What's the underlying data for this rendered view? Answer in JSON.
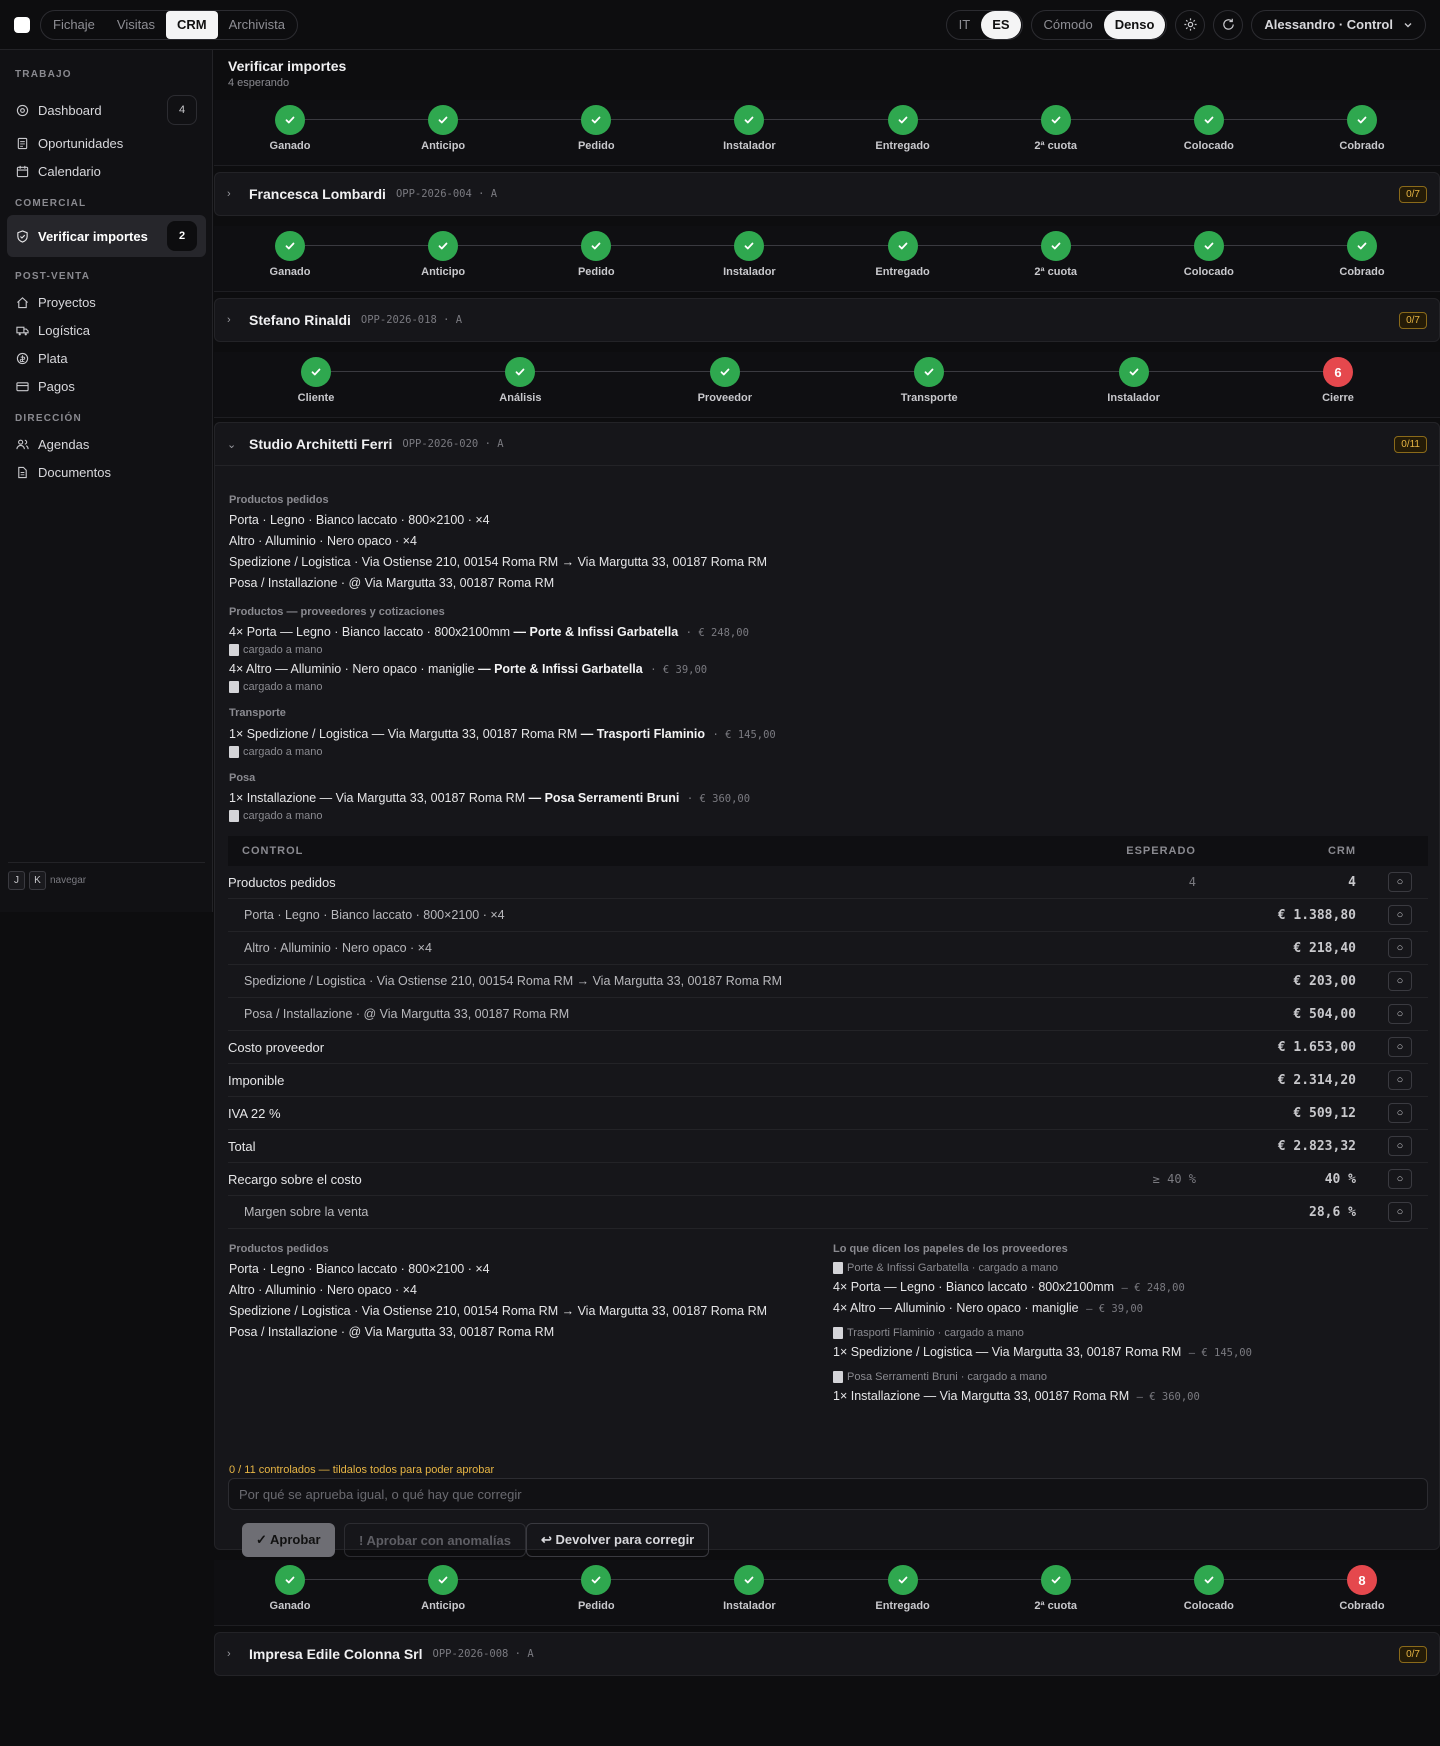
{
  "topbar": {
    "tabs": [
      "Fichaje",
      "Visitas",
      "CRM",
      "Archivista"
    ],
    "langs": [
      "IT",
      "ES"
    ],
    "density": [
      "Cómodo",
      "Denso"
    ],
    "user": "Alessandro · Control"
  },
  "sidebar": {
    "sections": {
      "trabajo": "TRABAJO",
      "comercial": "COMERCIAL",
      "postventa": "POST-VENTA",
      "direccion": "DIRECCIÓN"
    },
    "items": [
      {
        "label": "Dashboard",
        "badge": "4",
        "icon": "target-icon"
      },
      {
        "label": "Oportunidades",
        "icon": "document-icon"
      },
      {
        "label": "Calendario",
        "icon": "calendar-icon"
      },
      {
        "label": "Verificar importes",
        "badge": "2",
        "icon": "shield-icon"
      },
      {
        "label": "Proyectos",
        "icon": "home-icon"
      },
      {
        "label": "Logística",
        "icon": "truck-icon"
      },
      {
        "label": "Plata",
        "icon": "coin-icon"
      },
      {
        "label": "Pagos",
        "icon": "card-icon"
      },
      {
        "label": "Agendas",
        "icon": "users-icon"
      },
      {
        "label": "Documentos",
        "icon": "file-icon"
      }
    ],
    "footer": {
      "k1": "J",
      "k2": "K",
      "label": "navegar"
    }
  },
  "page": {
    "title": "Verificar importes",
    "subtitle": "4 esperando"
  },
  "steppers": {
    "standard": [
      "Ganado",
      "Anticipo",
      "Pedido",
      "Instalador",
      "Entregado",
      "2ª cuota",
      "Colocado",
      "Cobrado"
    ],
    "alt": [
      "Cliente",
      "Análisis",
      "Proveedor",
      "Transporte",
      "Instalador",
      "Cierre"
    ],
    "alt_failed_count": "6",
    "last_failed_count": "8"
  },
  "opps": [
    {
      "name": "Francesca Lombardi",
      "code": "OPP-2026-004 · A",
      "count": "0/7"
    },
    {
      "name": "Stefano Rinaldi",
      "code": "OPP-2026-018 · A",
      "count": "0/7"
    },
    {
      "name": "Studio Architetti Ferri",
      "code": "OPP-2026-020 · A",
      "count": "0/11"
    },
    {
      "name": "Impresa Edile Colonna Srl",
      "code": "OPP-2026-008 · A",
      "count": "0/7"
    }
  ],
  "detail": {
    "ordered_title": "Productos pedidos",
    "ordered": [
      "Porta · Legno · Bianco laccato · 800×2100 · ×4",
      "Altro · Alluminio · Nero opaco · ×4",
      "Spedizione / Logistica · Via Ostiense 210, 00154 Roma RM → Via Margutta 33, 00187 Roma RM",
      "Posa / Installazione · @ Via Margutta 33, 00187 Roma RM"
    ],
    "suppliers_title": "Productos — proveedores y cotizaciones",
    "transport_title": "Transporte",
    "posa_title": "Posa",
    "manual_note": "cargado a mano",
    "quotes": [
      {
        "text": "4× Porta — Legno · Bianco laccato · 800x2100mm",
        "supplier": "— Porte & Infissi Garbatella",
        "price": "· € 248,00"
      },
      {
        "text": "4× Altro — Alluminio · Nero opaco · maniglie",
        "supplier": "— Porte & Infissi Garbatella",
        "price": "· € 39,00"
      },
      {
        "text": "1× Spedizione / Logistica — Via Margutta 33, 00187 Roma RM",
        "supplier": "— Trasporti Flaminio",
        "price": "· € 145,00"
      },
      {
        "text": "1× Installazione — Via Margutta 33, 00187 Roma RM",
        "supplier": "— Posa Serramenti Bruni",
        "price": "· € 360,00"
      }
    ]
  },
  "control": {
    "headers": {
      "control": "CONTROL",
      "expected": "ESPERADO",
      "crm": "CRM"
    },
    "check_symbol": "○",
    "rows": [
      {
        "label": "Productos pedidos",
        "expected": "4",
        "crm": "4",
        "sub": false
      },
      {
        "label": "Porta · Legno · Bianco laccato · 800×2100 · ×4",
        "expected": "",
        "crm": "€ 1.388,80",
        "sub": true
      },
      {
        "label": "Altro · Alluminio · Nero opaco · ×4",
        "expected": "",
        "crm": "€ 218,40",
        "sub": true
      },
      {
        "label": "Spedizione / Logistica · Via Ostiense 210, 00154 Roma RM → Via Margutta 33, 00187 Roma RM",
        "expected": "",
        "crm": "€ 203,00",
        "sub": true
      },
      {
        "label": "Posa / Installazione · @ Via Margutta 33, 00187 Roma RM",
        "expected": "",
        "crm": "€ 504,00",
        "sub": true
      },
      {
        "label": "Costo proveedor",
        "expected": "",
        "crm": "€ 1.653,00",
        "sub": false
      },
      {
        "label": "Imponible",
        "expected": "",
        "crm": "€ 2.314,20",
        "sub": false
      },
      {
        "label": "IVA 22 %",
        "expected": "",
        "crm": "€ 509,12",
        "sub": false
      },
      {
        "label": "Total",
        "expected": "",
        "crm": "€ 2.823,32",
        "sub": false
      },
      {
        "label": "Recargo sobre el costo",
        "expected": "≥ 40 %",
        "crm": "40 %",
        "sub": false
      },
      {
        "label": "Margen sobre la venta",
        "expected": "",
        "crm": "28,6 %",
        "sub": true
      }
    ]
  },
  "papers": {
    "title": "Lo que dicen los papeles de los proveedores",
    "groups": [
      {
        "source": "Porte & Infissi Garbatella · cargado a mano",
        "lines": [
          {
            "text": "4× Porta — Legno · Bianco laccato · 800x2100mm",
            "price": "— € 248,00"
          },
          {
            "text": "4× Altro — Alluminio · Nero opaco · maniglie",
            "price": "— € 39,00"
          }
        ]
      },
      {
        "source": "Trasporti Flaminio · cargado a mano",
        "lines": [
          {
            "text": "1× Spedizione / Logistica — Via Margutta 33, 00187 Roma RM",
            "price": "— € 145,00"
          }
        ]
      },
      {
        "source": "Posa Serramenti Bruni · cargado a mano",
        "lines": [
          {
            "text": "1× Installazione — Via Margutta 33, 00187 Roma RM",
            "price": "— € 360,00"
          }
        ]
      }
    ]
  },
  "footer": {
    "warning": "0 / 11 controlados — tildalos todos para poder aprobar",
    "reason_placeholder": "Por qué se aprueba igual, o qué hay que corregir",
    "approve": "✓ Aprobar",
    "approve_anomalies": "! Aprobar con anomalías",
    "return": "↩ Devolver para corregir"
  },
  "colors": {
    "done": "#2fa84f",
    "failed": "#e5484d",
    "warning": "#e7b544"
  }
}
